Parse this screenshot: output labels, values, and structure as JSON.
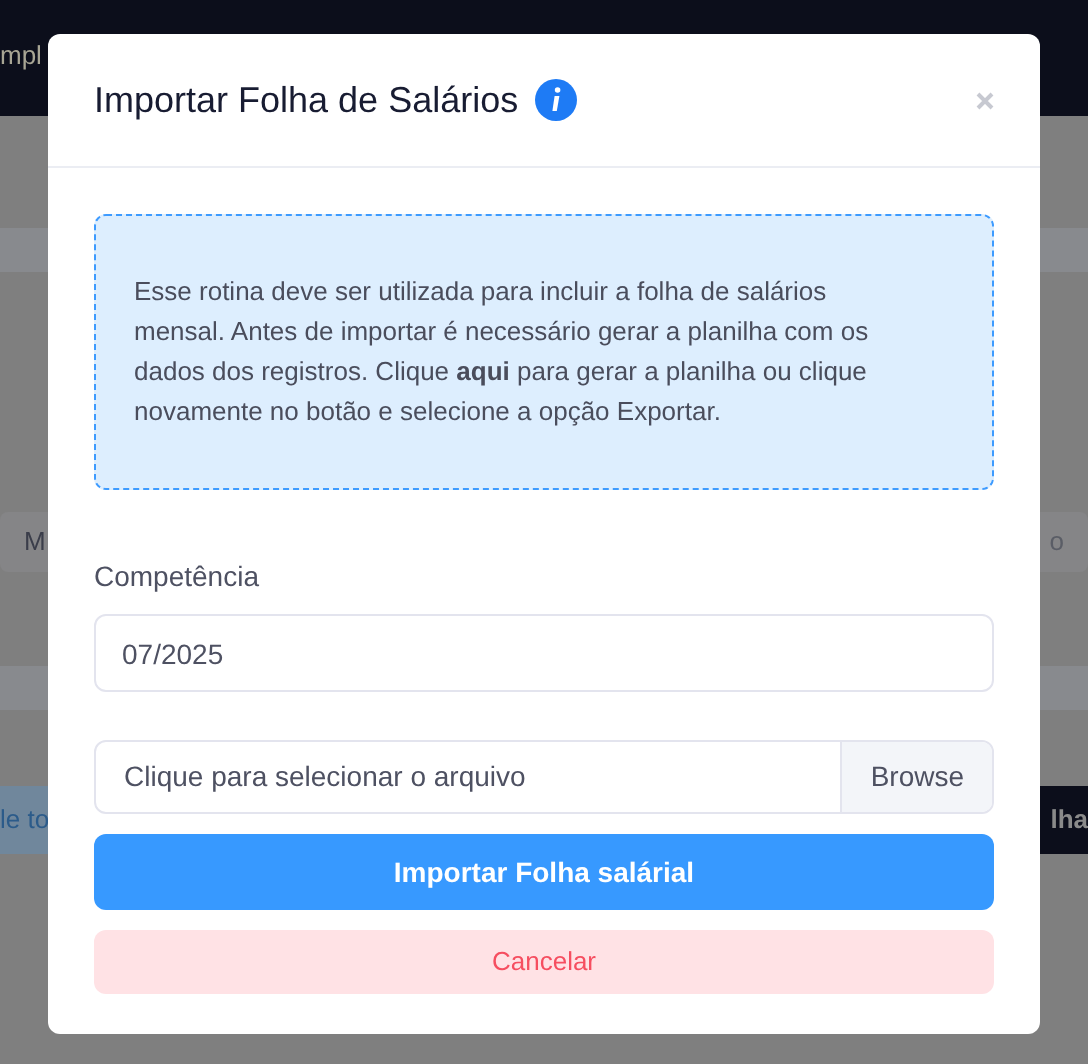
{
  "background": {
    "header_text": "mpl",
    "chip_left": "M",
    "chip_right": "o",
    "button_left": "le to",
    "button_right": "lha"
  },
  "dialog": {
    "title": "Importar Folha de Salários",
    "info": "Esse rotina deve ser utilizada para incluir a folha de salários mensal. Antes de importar é necessário gerar a planilha com os dados dos registros. Clique **aqui** para gerar a planilha ou clique novamente no botão e selecione a opção Exportar.",
    "competencia": {
      "label": "Competência",
      "value": "07/2025"
    },
    "file": {
      "placeholder": "Clique para selecionar o arquivo",
      "browse": "Browse"
    },
    "buttons": [
      {
        "kind": "primary",
        "label": "Importar Folha salárial"
      },
      {
        "kind": "cancel",
        "label": "Cancelar"
      }
    ]
  }
}
